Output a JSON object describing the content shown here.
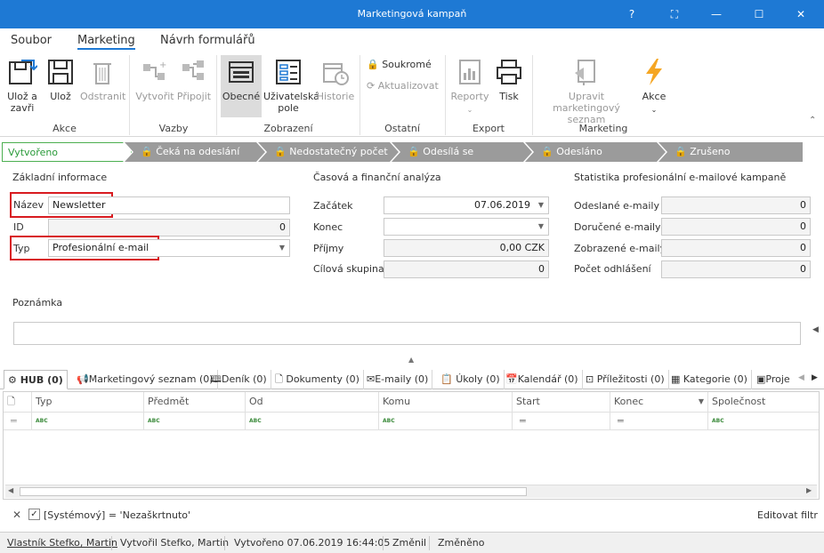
{
  "window": {
    "title": "Marketingová kampaň"
  },
  "menu": {
    "tabs": [
      "Soubor",
      "Marketing",
      "Návrh formulářů"
    ]
  },
  "ribbon": {
    "buttons": {
      "save_close": "Ulož a zavři",
      "save": "Ulož",
      "remove": "Odstranit",
      "create": "Vytvořit",
      "attach": "Připojit",
      "general": "Obecné",
      "user_field": "Uživatelská pole",
      "history": "Historie",
      "private": "Soukromé",
      "refresh": "Aktualizovat",
      "reports": "Reporty",
      "print": "Tisk",
      "edit_list": "Upravit marketingový seznam",
      "actions": "Akce"
    },
    "groups": [
      "Akce",
      "Vazby",
      "Zobrazení",
      "Ostatní",
      "Export",
      "Marketing"
    ]
  },
  "steps": [
    "Vytvořeno",
    "Čeká na odeslání",
    "Nedostatečný počet ...",
    "Odesílá se",
    "Odesláno",
    "Zrušeno"
  ],
  "basic": {
    "title": "Základní informace",
    "name_label": "Název",
    "name_value": "Newsletter",
    "id_label": "ID",
    "id_value": "0",
    "type_label": "Typ",
    "type_value": "Profesionální e-mail"
  },
  "time": {
    "title": "Časová a finanční analýza",
    "start_label": "Začátek",
    "start_value": "07.06.2019",
    "end_label": "Konec",
    "end_value": "",
    "income_label": "Příjmy",
    "income_value": "0,00 CZK",
    "target_label": "Cílová skupina",
    "target_value": "0"
  },
  "stats": {
    "title": "Statistika profesionální e-mailové kampaně",
    "sent_label": "Odeslané e-maily",
    "sent_value": "0",
    "delivered_label": "Doručené e-maily",
    "delivered_value": "0",
    "shown_label": "Zobrazené e-maily",
    "shown_value": "0",
    "unsub_label": "Počet odhlášení",
    "unsub_value": "0"
  },
  "note": {
    "label": "Poznámka",
    "value": ""
  },
  "tabs": [
    "HUB (0)",
    "Marketingový seznam (0)",
    "Deník (0)",
    "Dokumenty (0)",
    "E-maily (0)",
    "Úkoly (0)",
    "Kalendář (0)",
    "Příležitosti (0)",
    "Kategorie (0)",
    "Proje"
  ],
  "grid": {
    "columns": [
      "Typ",
      "Předmět",
      "Od",
      "Komu",
      "Start",
      "Konec",
      "Společnost"
    ]
  },
  "filter": {
    "text": "[Systémový] = 'Nezaškrtnuto'",
    "edit": "Editovat filtr"
  },
  "status": {
    "owner": "Vlastník Stefko, Martin",
    "created_by": "Vytvořil Stefko, Martin",
    "created": "Vytvořeno 07.06.2019 16:44:05",
    "changed_by": "Změnil",
    "changed": "Změněno"
  },
  "colors": {
    "accent": "#1e79d4",
    "highlight": "#d81b20",
    "step_active": "#4caf50",
    "step_inactive": "#9b9b9b"
  }
}
